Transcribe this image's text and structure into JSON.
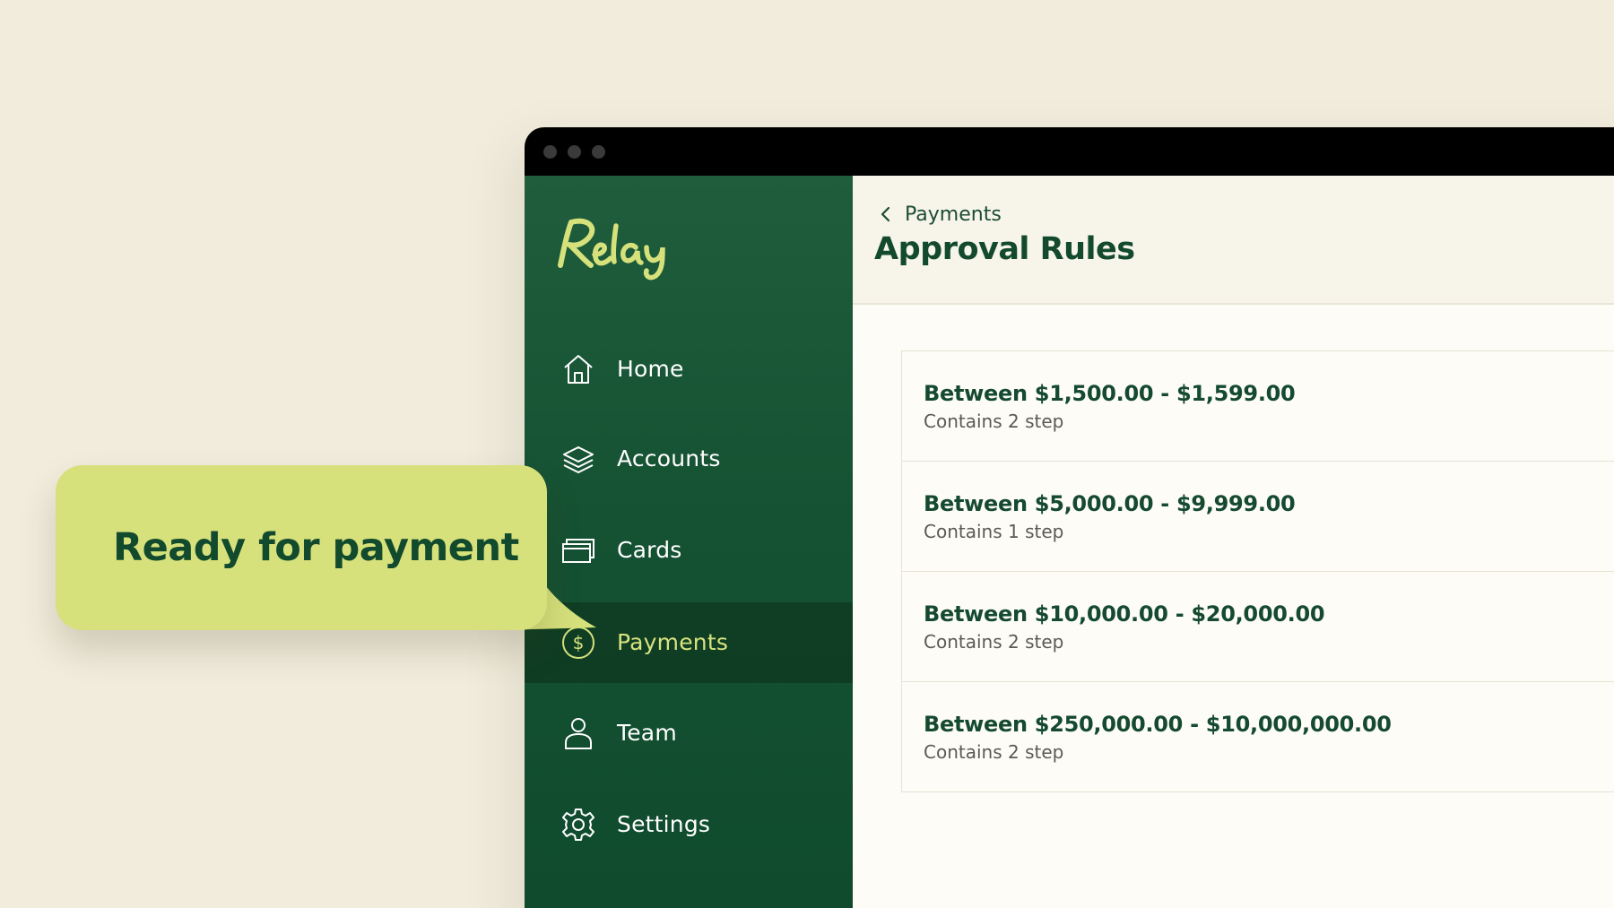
{
  "brand": {
    "logo_text": "Relay",
    "logo_color": "#d6e17b"
  },
  "colors": {
    "background": "#f1ecdc",
    "sidebar": "#155233",
    "accent": "#d6e17b",
    "title_green": "#134a2e"
  },
  "sidebar": {
    "items": [
      {
        "label": "Home",
        "icon": "home-icon",
        "active": false
      },
      {
        "label": "Accounts",
        "icon": "layers-icon",
        "active": false
      },
      {
        "label": "Cards",
        "icon": "card-icon",
        "active": false
      },
      {
        "label": "Payments",
        "icon": "dollar-icon",
        "active": true
      },
      {
        "label": "Team",
        "icon": "person-icon",
        "active": false
      },
      {
        "label": "Settings",
        "icon": "gear-icon",
        "active": false
      }
    ]
  },
  "header": {
    "back_label": "Payments",
    "back_icon": "chevron-left-icon",
    "title": "Approval Rules"
  },
  "rules": [
    {
      "title": "Between $1,500.00 - $1,599.00",
      "subtitle": "Contains 2 step"
    },
    {
      "title": "Between $5,000.00 - $9,999.00",
      "subtitle": "Contains 1 step"
    },
    {
      "title": "Between $10,000.00 - $20,000.00",
      "subtitle": "Contains 2 step"
    },
    {
      "title": "Between $250,000.00 - $10,000,000.00",
      "subtitle": "Contains 2 step"
    }
  ],
  "callout": {
    "text": "Ready for payment"
  }
}
